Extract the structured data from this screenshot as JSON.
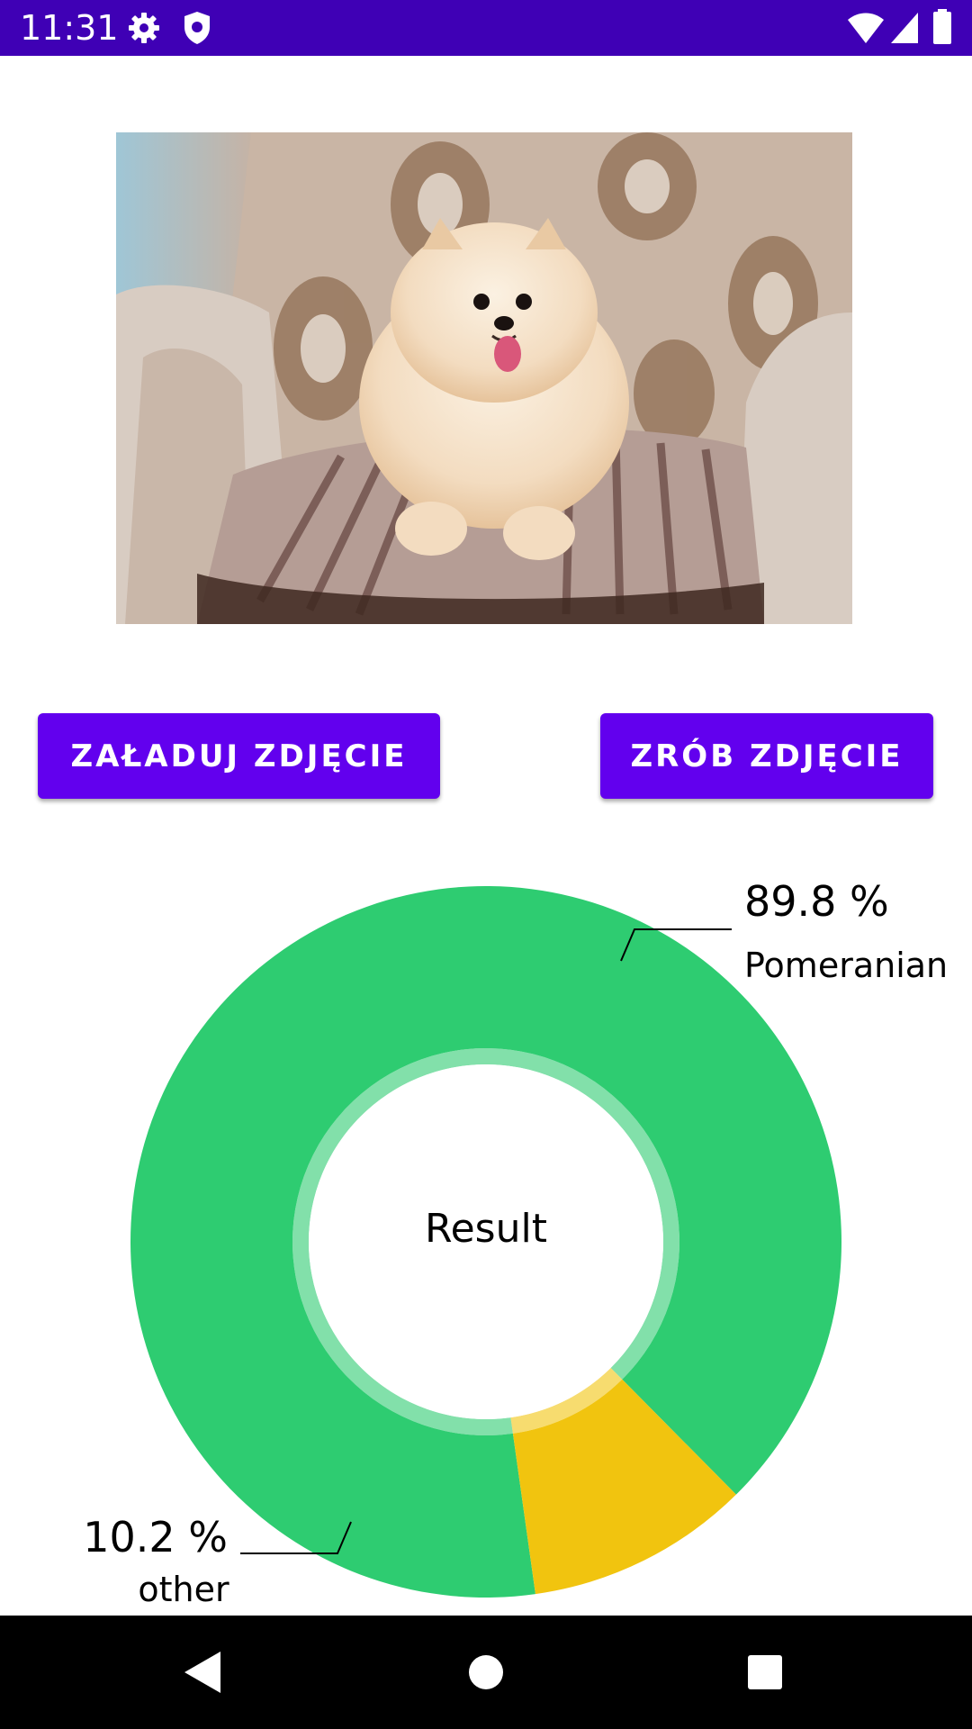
{
  "status_bar": {
    "time": "11:31",
    "background": "#3f00b5",
    "icons": [
      "settings-icon",
      "shield-icon",
      "wifi-icon",
      "signal-icon",
      "battery-icon"
    ]
  },
  "photo": {
    "subject": "pomeranian-dog-photo"
  },
  "buttons": {
    "load_label": "ZAŁADUJ ZDJĘCIE",
    "take_label": "ZRÓB ZDJĘCIE",
    "color": "#6200ee"
  },
  "chart_data": {
    "type": "pie",
    "center_label": "Result",
    "slices": [
      {
        "label": "Pomeranian",
        "value": 89.8,
        "value_label": "89.8 %",
        "color": "#2ecc71"
      },
      {
        "label": "other",
        "value": 10.2,
        "value_label": "10.2 %",
        "color": "#f1c40f"
      }
    ]
  },
  "nav_bar": {
    "icons": [
      "back-icon",
      "home-icon",
      "recents-icon"
    ]
  }
}
